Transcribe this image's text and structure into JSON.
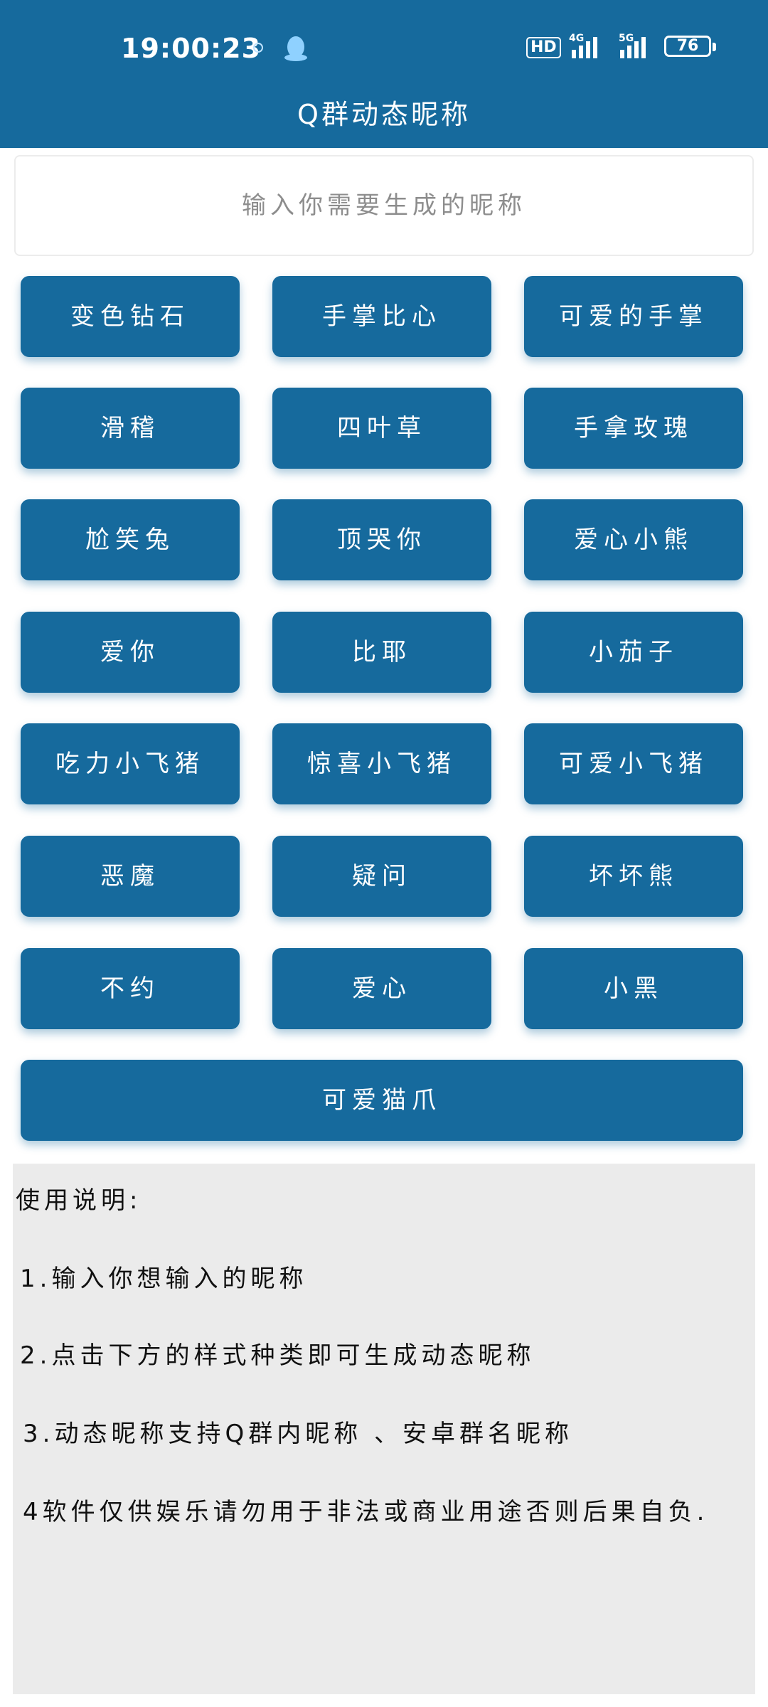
{
  "status": {
    "time": "19:00:23",
    "hd": "HD",
    "net1": "4G",
    "net2": "5G",
    "battery": "76"
  },
  "header": {
    "title": "Q群动态昵称"
  },
  "input": {
    "placeholder": "输入你需要生成的昵称"
  },
  "buttons": [
    "变色钻石",
    "手掌比心",
    "可爱的手掌",
    "滑稽",
    "四叶草",
    "手拿玫瑰",
    "尬笑兔",
    "顶哭你",
    "爱心小熊",
    "爱你",
    "比耶",
    "小茄子",
    "吃力小飞猪",
    "惊喜小飞猪",
    "可爱小飞猪",
    "恶魔",
    "疑问",
    "坏坏熊",
    "不约",
    "爱心",
    "小黑",
    "可爱猫爪"
  ],
  "instructions": {
    "heading": "使用说明:",
    "items": [
      "1.输入你想输入的昵称",
      "2.点击下方的样式种类即可生成动态昵称",
      "3.动态昵称支持Q群内昵称 、安卓群名昵称",
      "4软件仅供娱乐请勿用于非法或商业用途否则后果自负."
    ]
  },
  "colors": {
    "primary": "#166a9d",
    "panel": "#ebebeb"
  }
}
